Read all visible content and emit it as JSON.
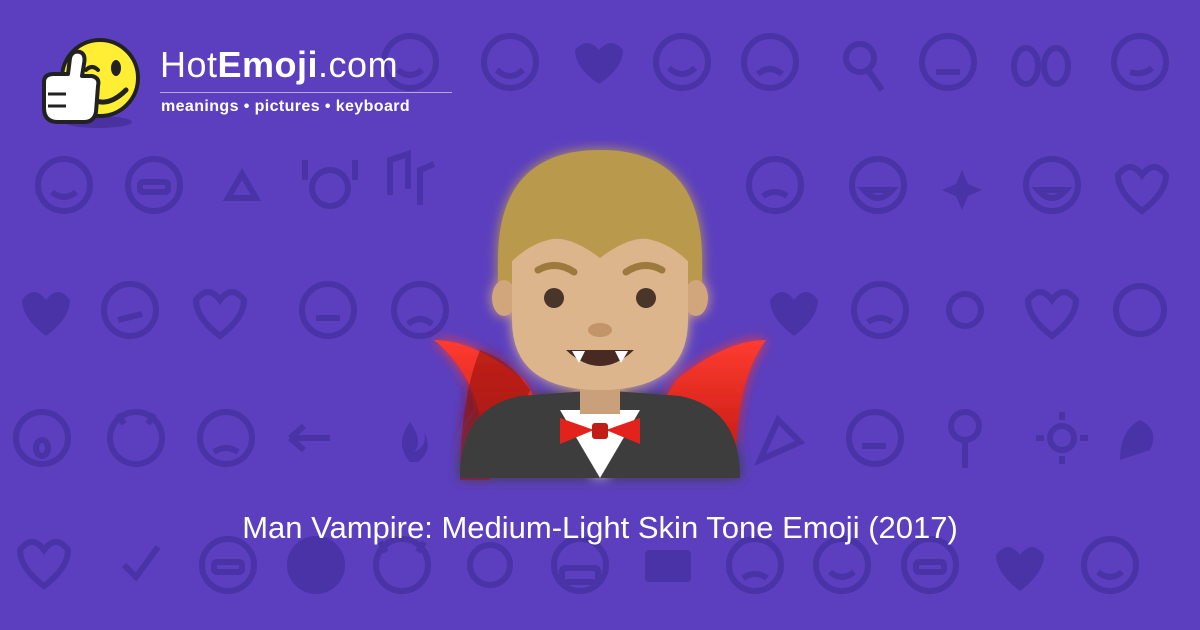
{
  "colors": {
    "background": "#5b3fbf",
    "pattern": "#4a32a6",
    "text": "#ffffff"
  },
  "logo": {
    "name_prefix": "Hot",
    "name_bold": "Emoji",
    "name_suffix": ".com",
    "tagline": "meanings • pictures • keyboard",
    "mascot_icon": "thumbs-up-wink-face-icon"
  },
  "hero": {
    "icon": "man-vampire-medium-light-skin-tone-icon"
  },
  "caption": "Man Vampire: Medium-Light Skin Tone Emoji (2017)"
}
